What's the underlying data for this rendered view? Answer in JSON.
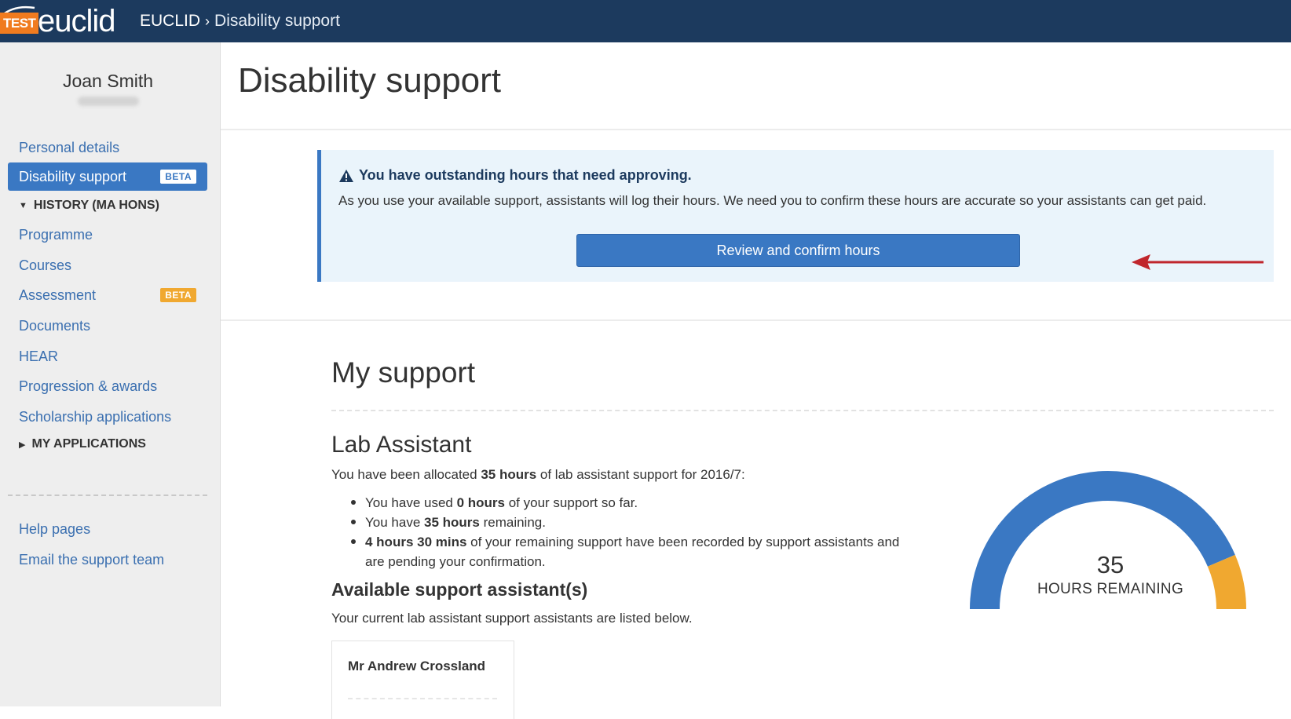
{
  "brand": {
    "test_badge": "TEST",
    "wordmark": "euclid"
  },
  "breadcrumb": {
    "root": "EUCLID",
    "separator": "›",
    "current": "Disability support"
  },
  "sidebar": {
    "user_name": "Joan Smith",
    "items": [
      {
        "label": "Personal details"
      },
      {
        "label": "Disability support",
        "badge": "BETA"
      },
      {
        "label": "Programme"
      },
      {
        "label": "Courses"
      },
      {
        "label": "Assessment",
        "badge": "BETA"
      },
      {
        "label": "Documents"
      },
      {
        "label": "HEAR"
      },
      {
        "label": "Progression & awards"
      },
      {
        "label": "Scholarship applications"
      },
      {
        "label": "Help pages"
      },
      {
        "label": "Email the support team"
      }
    ],
    "headers": [
      {
        "label": "HISTORY (MA HONS)"
      },
      {
        "label": "MY APPLICATIONS"
      }
    ]
  },
  "page": {
    "title": "Disability support"
  },
  "alert": {
    "heading": "You have outstanding hours that need approving.",
    "body": "As you use your available support, assistants will log their hours. We need you to confirm these hours are accurate so your assistants can get paid.",
    "button_label": "Review and confirm hours"
  },
  "support": {
    "title": "My support",
    "lab": {
      "title": "Lab Assistant",
      "alloc_pre": "You have been allocated ",
      "alloc_strong": "35 hours",
      "alloc_post": " of lab assistant support for 2016/7:",
      "bullets": [
        {
          "pre": "You have used ",
          "strong": "0 hours",
          "post": " of your support so far."
        },
        {
          "pre": "You have ",
          "strong": "35 hours",
          "post": " remaining."
        },
        {
          "pre": "",
          "strong": "4 hours 30 mins",
          "post": " of your remaining support have been recorded by support assistants and are pending your confirmation."
        }
      ]
    },
    "available": {
      "title": "Available support assistant(s)",
      "description": "Your current lab assistant support assistants are listed below.",
      "assistants": [
        {
          "name": "Mr Andrew Crossland"
        }
      ]
    },
    "gauge": {
      "value": "35",
      "label": "HOURS REMAINING",
      "allocated_hours": 35,
      "pending_hours": 4.5,
      "colors": {
        "remaining": "#3a78c3",
        "pending": "#f0a830"
      }
    }
  },
  "colors": {
    "topbar": "#1c3a5e",
    "accent": "#3a78c3",
    "beta_orange": "#f0a830",
    "test_orange": "#f07b1f"
  }
}
